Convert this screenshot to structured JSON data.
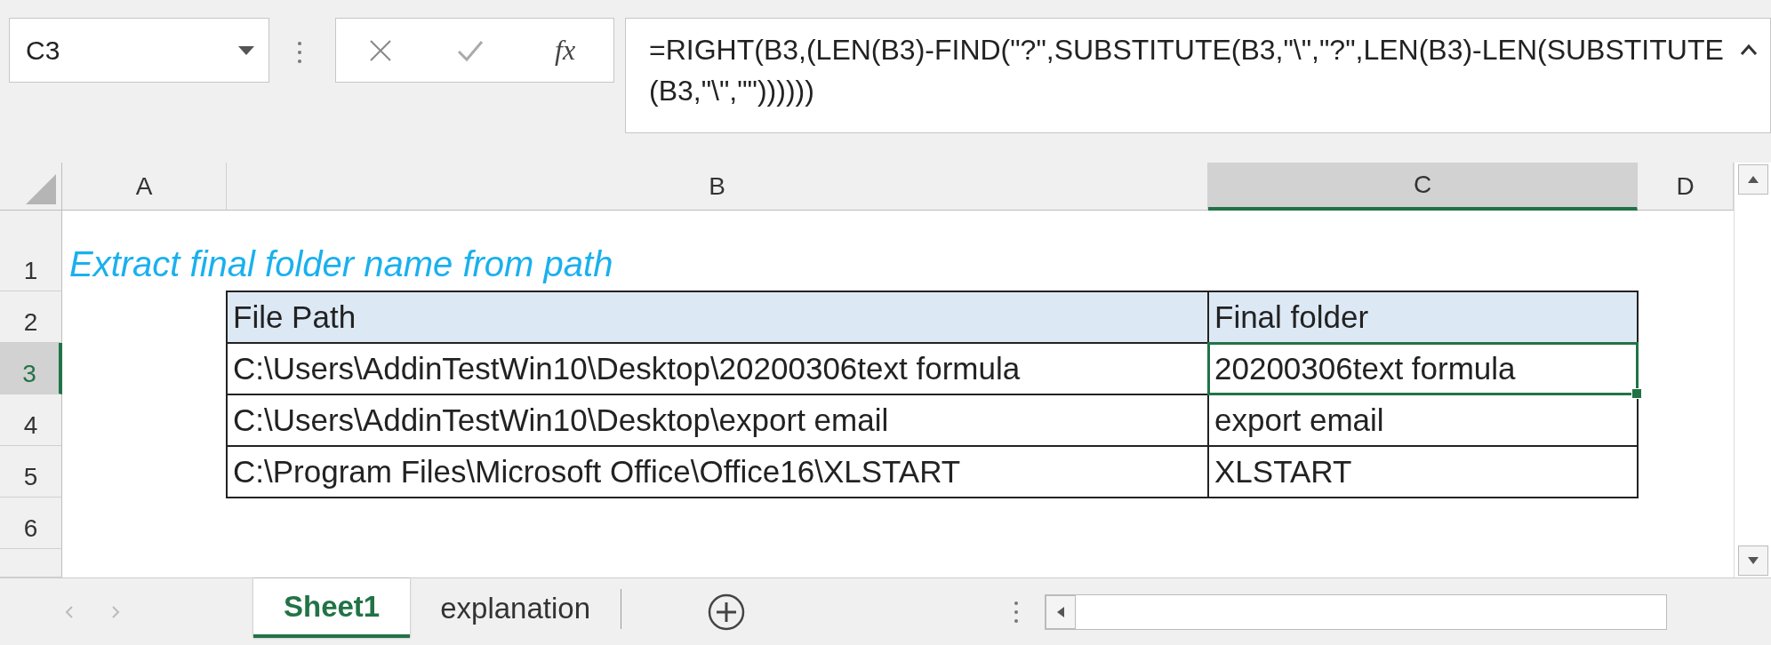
{
  "name_box": {
    "value": "C3"
  },
  "formula_bar": {
    "function_label": "fx",
    "formula": "=RIGHT(B3,(LEN(B3)-FIND(\"?\",SUBSTITUTE(B3,\"\\\",\"?\",LEN(B3)-LEN(SUBSTITUTE(B3,\"\\\",\"\"))))))"
  },
  "columns": [
    {
      "label": "A",
      "selected": false
    },
    {
      "label": "B",
      "selected": false
    },
    {
      "label": "C",
      "selected": true
    },
    {
      "label": "D",
      "selected": false
    }
  ],
  "rows": [
    {
      "label": "1",
      "selected": false
    },
    {
      "label": "2",
      "selected": false
    },
    {
      "label": "3",
      "selected": true
    },
    {
      "label": "4",
      "selected": false
    },
    {
      "label": "5",
      "selected": false
    },
    {
      "label": "6",
      "selected": false
    }
  ],
  "title": "Extract final folder name from path",
  "table": {
    "headers": [
      "File Path",
      "Final folder"
    ],
    "rows": [
      {
        "cells": [
          {
            "text": "C:\\Users\\AddinTestWin10\\Desktop\\20200306text formula",
            "selected": false
          },
          {
            "text": "20200306text formula",
            "selected": true
          }
        ]
      },
      {
        "cells": [
          {
            "text": "C:\\Users\\AddinTestWin10\\Desktop\\export email",
            "selected": false
          },
          {
            "text": "export email",
            "selected": false
          }
        ]
      },
      {
        "cells": [
          {
            "text": "C:\\Program Files\\Microsoft Office\\Office16\\XLSTART",
            "selected": false
          },
          {
            "text": "XLSTART",
            "selected": false
          }
        ]
      }
    ]
  },
  "sheet_tabs": [
    {
      "label": "Sheet1",
      "selected": true
    },
    {
      "label": "explanation",
      "selected": false
    }
  ]
}
